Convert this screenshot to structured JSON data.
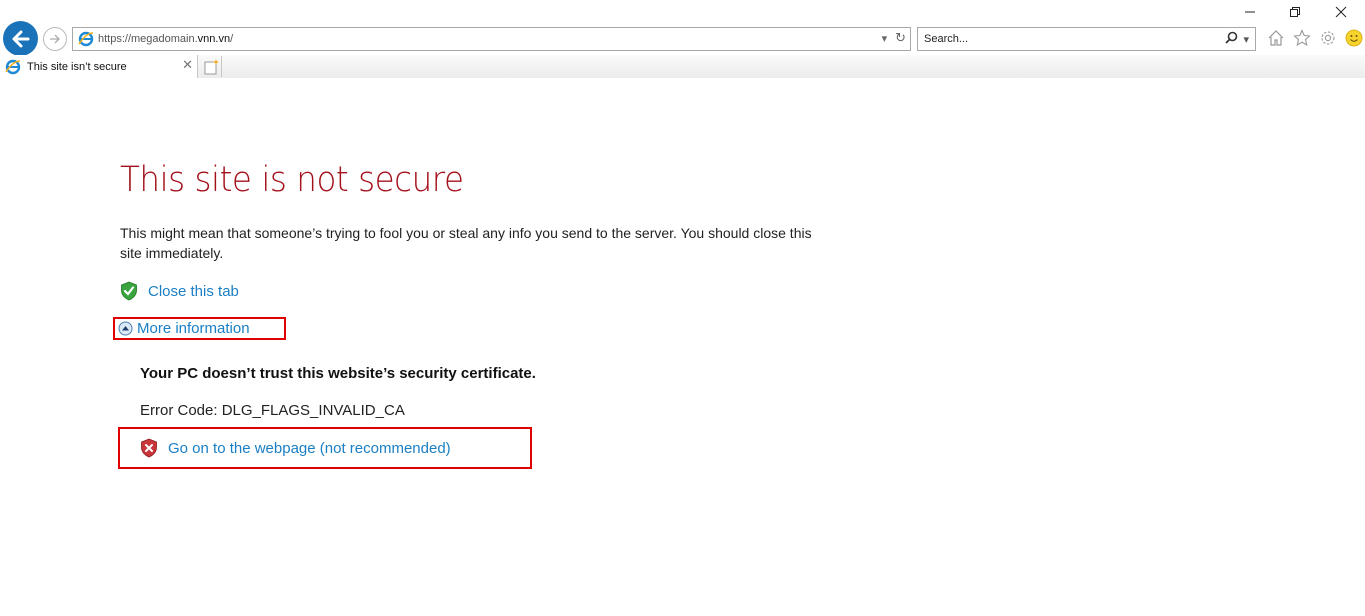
{
  "browser": {
    "address_url": "https://megadomain.vnn.vn/",
    "address_prefix": "https://megadomain.",
    "address_domain": "vnn.vn",
    "address_suffix": "/",
    "search_placeholder": "Search...",
    "tabs": [
      {
        "title": "This site isn’t secure",
        "active": true
      }
    ],
    "window_controls": [
      "minimize",
      "restore",
      "close"
    ],
    "toolbar_icons": [
      "home-icon",
      "favorites-star-icon",
      "settings-gear-icon",
      "feedback-smiley-icon"
    ]
  },
  "page": {
    "title": "This site is not secure",
    "description": "This might mean that someone’s trying to fool you or steal any info you send to the server. You should close this site immediately.",
    "close_tab_link": "Close this tab",
    "more_info_link": "More information",
    "cert_message": "Your PC doesn’t trust this website’s security certificate.",
    "error_code_label": "Error Code: DLG_FLAGS_INVALID_CA",
    "go_on_link": "Go on to the webpage (not recommended)"
  },
  "colors": {
    "title_red": "#a4111b",
    "link_blue": "#1a7fc4",
    "highlight_box_red": "#e00000",
    "back_button_blue": "#1a73b8"
  }
}
